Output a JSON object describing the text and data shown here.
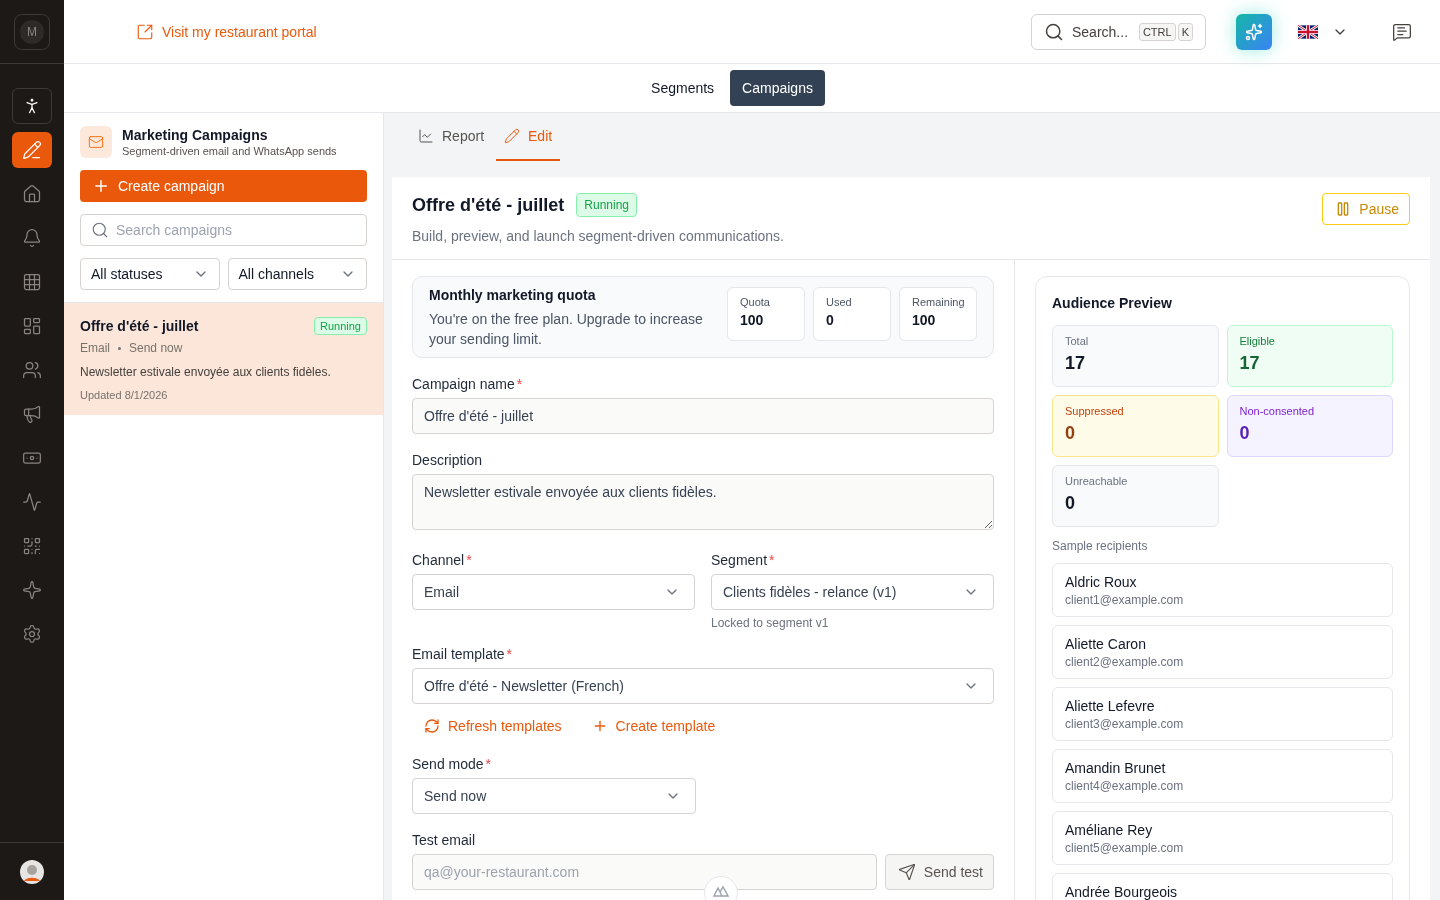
{
  "sidebar": {
    "logo_letter": "M",
    "items": [
      {
        "kind": "mode",
        "selected": false
      },
      {
        "kind": "nav",
        "selected": true
      },
      {
        "kind": "nav",
        "selected": false
      },
      {
        "kind": "nav",
        "selected": false
      },
      {
        "kind": "nav",
        "selected": false
      },
      {
        "kind": "nav",
        "selected": false
      },
      {
        "kind": "nav",
        "selected": false
      },
      {
        "kind": "nav",
        "selected": false
      },
      {
        "kind": "nav",
        "selected": false
      },
      {
        "kind": "nav",
        "selected": false
      },
      {
        "kind": "nav",
        "selected": false
      },
      {
        "kind": "nav",
        "selected": false
      },
      {
        "kind": "nav",
        "selected": false
      }
    ]
  },
  "topbar": {
    "portal_link": "Visit my restaurant portal",
    "search": {
      "placeholder": "Search...",
      "keys": [
        "CTRL",
        "K"
      ]
    }
  },
  "section_tabs": [
    {
      "label": "Segments",
      "selected": false
    },
    {
      "label": "Campaigns",
      "selected": true
    }
  ],
  "campaign_list": {
    "title": "Marketing Campaigns",
    "subtitle": "Segment-driven email and WhatsApp sends",
    "create_button": "Create campaign",
    "search": {
      "placeholder": "Search campaigns"
    },
    "filters": [
      "All statuses",
      "All channels"
    ],
    "campaigns": [
      {
        "title": "Offre d'été - juillet",
        "status": "Running",
        "channel": "Email",
        "mode": "Send now",
        "description": "Newsletter estivale envoyée aux clients fidèles.",
        "updated": "Updated 8/1/2026",
        "selected": true
      }
    ]
  },
  "detail_tabs": [
    {
      "label": "Report",
      "selected": false
    },
    {
      "label": "Edit",
      "selected": true
    }
  ],
  "header": {
    "title": "Offre d'été - juillet",
    "status": "Running",
    "subtitle": "Build, preview, and launch segment-driven communications.",
    "pause_button": "Pause"
  },
  "quota": {
    "title": "Monthly marketing quota",
    "text": "You're on the free plan. Upgrade to increase your sending limit.",
    "stats": [
      {
        "label": "Quota",
        "value": "100"
      },
      {
        "label": "Used",
        "value": "0"
      },
      {
        "label": "Remaining",
        "value": "100"
      }
    ]
  },
  "form": {
    "campaign_name": {
      "label": "Campaign name",
      "required_mark": "*",
      "value": "Offre d'été - juillet"
    },
    "description": {
      "label": "Description",
      "value": "Newsletter estivale envoyée aux clients fidèles."
    },
    "channel": {
      "label": "Channel",
      "required_mark": "*",
      "value": "Email"
    },
    "segment": {
      "label": "Segment",
      "required_mark": "*",
      "value": "Clients fidèles - relance (v1)",
      "hint": "Locked to segment v1"
    },
    "template": {
      "label": "Email template",
      "required_mark": "*",
      "value": "Offre d'été - Newsletter (French)"
    },
    "template_actions": [
      "Refresh templates",
      "Create template"
    ],
    "send_mode": {
      "label": "Send mode",
      "required_mark": "*",
      "value": "Send now"
    },
    "test_email": {
      "label": "Test email",
      "placeholder": "qa@your-restaurant.com",
      "button": "Send test"
    }
  },
  "audience": {
    "title": "Audience Preview",
    "stats": [
      {
        "label": "Total",
        "value": "17",
        "kind": "neutral"
      },
      {
        "label": "Eligible",
        "value": "17",
        "kind": "green"
      },
      {
        "label": "Suppressed",
        "value": "0",
        "kind": "amber"
      },
      {
        "label": "Non-consented",
        "value": "0",
        "kind": "purple"
      },
      {
        "label": "Unreachable",
        "value": "0",
        "kind": "neutral"
      }
    ],
    "sample_label": "Sample recipients",
    "recipients": [
      {
        "name": "Aldric Roux",
        "email": "client1@example.com"
      },
      {
        "name": "Aliette Caron",
        "email": "client2@example.com"
      },
      {
        "name": "Aliette Lefevre",
        "email": "client3@example.com"
      },
      {
        "name": "Amandin Brunet",
        "email": "client4@example.com"
      },
      {
        "name": "Améliane Rey",
        "email": "client5@example.com"
      },
      {
        "name": "Andrée Bourgeois"
      }
    ]
  }
}
